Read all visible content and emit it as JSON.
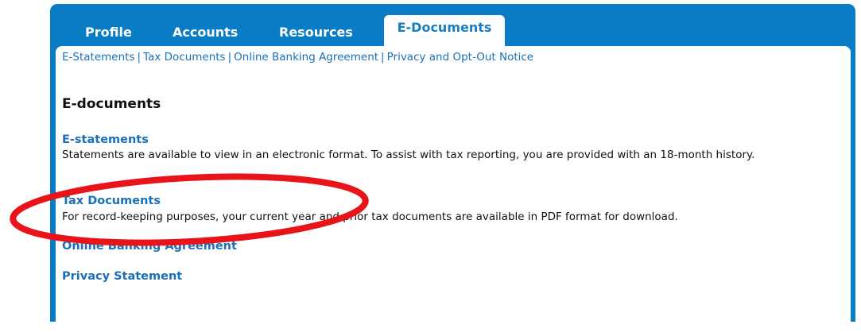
{
  "tabs": [
    {
      "label": "Profile"
    },
    {
      "label": "Accounts"
    },
    {
      "label": "Resources"
    },
    {
      "label": "E-Documents",
      "active": true
    }
  ],
  "subnav": [
    {
      "label": "E-Statements"
    },
    {
      "label": "Tax Documents"
    },
    {
      "label": "Online Banking Agreement"
    },
    {
      "label": "Privacy and Opt-Out Notice"
    }
  ],
  "main": {
    "heading": "E-documents",
    "sections": [
      {
        "title": "E-statements",
        "description": "Statements are available to view in an electronic format. To assist with tax reporting, you are provided with an 18-month history."
      },
      {
        "title": "Tax Documents",
        "description": "For record-keeping purposes, your current year and prior tax documents are available in PDF format for download."
      },
      {
        "title": "Online Banking Agreement"
      },
      {
        "title": "Privacy Statement"
      }
    ]
  },
  "colors": {
    "frame_blue": "#0a7cc5",
    "link_blue": "#1a70b8",
    "annotation_red": "#e8141a"
  }
}
